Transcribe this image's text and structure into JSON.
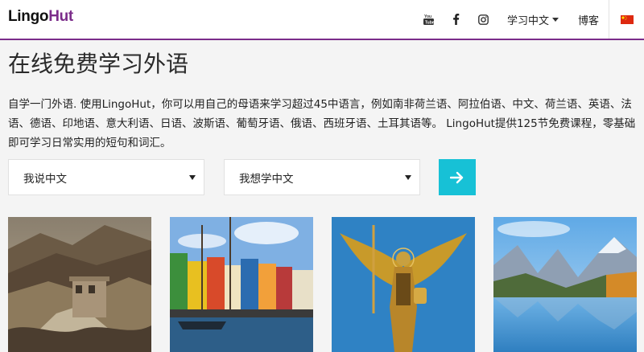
{
  "header": {
    "logo_part1": "Lingo",
    "logo_part2": "Hut",
    "nav": {
      "language_menu_label": "学习中文",
      "blog_label": "博客",
      "icons": [
        "youtube-icon",
        "facebook-icon",
        "instagram-icon",
        "china-flag-icon"
      ]
    }
  },
  "main": {
    "title": "在线免费学习外语",
    "description": "自学一门外语. 使用LingoHut，你可以用自己的母语来学习超过45中语言，例如南非荷兰语、阿拉伯语、中文、荷兰语、英语、法语、德语、印地语、意大利语、日语、波斯语、葡萄牙语、俄语、西班牙语、土耳其语等。 LingoHut提供125节免费课程，零基础即可学习日常实用的短句和词汇。",
    "speak_select": "我说中文",
    "learn_select": "我想学中文",
    "go_icon": "arrow-right-icon"
  },
  "colors": {
    "brand_purple": "#7b2c8a",
    "accent_cyan": "#17c1d6",
    "page_bg": "#f4f4f4"
  },
  "photos": [
    "great-wall-photo",
    "colorful-harbor-photo",
    "golden-angel-statue-photo",
    "mountain-lake-photo"
  ]
}
